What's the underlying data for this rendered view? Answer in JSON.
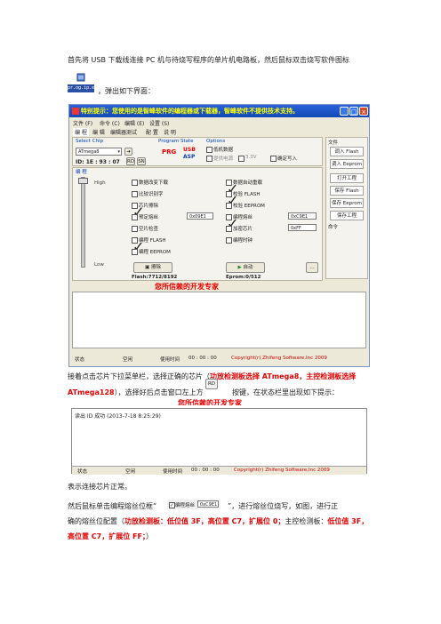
{
  "intro_text": "首先将 USB 下载线连接 PC 机与待烧写程序的单片机电路板，然后鼠标双击烧写软件图标",
  "icon_caption": "pr.og.ip.exe",
  "after_icon_text": "，弹出如下界面：",
  "window": {
    "title": "特别提示：您使用的是智峰软件的编程器或下载器，智峰软件不提供技术支持。",
    "menu": [
      "文件 (F)",
      "命令 (C)",
      "编辑 (E)",
      "设置 (S)"
    ],
    "tabs": [
      "编 程",
      "编 辑",
      "编辑器测试",
      "配 置",
      "说 明"
    ],
    "select_chip_label": "Select Chip",
    "chip_value": "ATmega8",
    "id_text": "ID: 1E : 93 : 07",
    "rd_label": "RD",
    "sn_label": "SN",
    "program_state_label": "Program State",
    "prg_label": "PRG",
    "usb_label": "USB",
    "asp_label": "ASP",
    "options_label": "Options",
    "opt_freq": "低机数据",
    "opt_dc": "提供电源",
    "opt_33": "3.3V",
    "opt_burn": "确定写入",
    "section_label": "编 程",
    "high_label": "High",
    "low_label": "Low",
    "left_options": [
      "数据改变下载",
      "比较识别字",
      "芯片擦除",
      "预定熔丝",
      "空片检查",
      "编程 FLASH",
      "编程 EEPROM"
    ],
    "right_options": [
      "数据自动重载",
      "校验 FLASH",
      "校验 EEPROM",
      "编程熔丝",
      "加密芯片",
      "编程时钟"
    ],
    "fuse_left": "0x09E1",
    "fuse_right1": "0xC9E1",
    "fuse_right2": "0xFF",
    "erase_label": "擦除",
    "auto_label": "自动",
    "more_label": "...",
    "flash_text": "Flash:7712/8192",
    "eeprom_text": "Eprom:0/512",
    "slogan": "您所信赖的开发专家",
    "side_header": "文件",
    "side_buttons": [
      "调入 Flash",
      "调入 Eeprom",
      "打开工程",
      "保存 Flash",
      "保存 Eeprom",
      "保存工程"
    ],
    "side_footer": "命令",
    "status": [
      "状态",
      "空闲",
      "使用时间",
      "00 : 00 : 00",
      "Copyright(r) Zhifeng Software,Inc 2009"
    ]
  },
  "para2_a": "接着点击芯片下拉菜单栏，选择正确的芯片（",
  "para2_red1": "功放检测板选择 ATmega8，主控检测板选择",
  "para2_red2": "ATmega128",
  "para2_b": "），选择好后点击窗口左上方",
  "para2_c": "按键，在状态栏里出现如下提示：",
  "rd_button": "RD",
  "status_window": {
    "slogan": "您所信赖的开发专家",
    "log": "读出 ID 成功 (2013-7-18 8:25:29)",
    "status": [
      "状态",
      "空闲",
      "使用时间",
      "00 : 00 : 00",
      "Copyright(r) Zhifeng Software,Inc 2009"
    ]
  },
  "para3": "表示连接芯片正常。",
  "para4_a": "然后鼠标单击编程熔丝位框“",
  "para4_inline_label": "编程熔丝",
  "para4_inline_value": "0xC9E1",
  "para4_b": "”，进行熔丝位烧写，如图，进行正",
  "para5_a": "确的熔丝位配置（",
  "para5_red": "功放检测板：低位值 3F，高位置 C7，扩展位 0；",
  "para5_b": "主控检测板：",
  "para5_red2": "低位值 3F，",
  "para6_red": "高位置 C7，扩展位 FF；",
  "para6_b": "）"
}
